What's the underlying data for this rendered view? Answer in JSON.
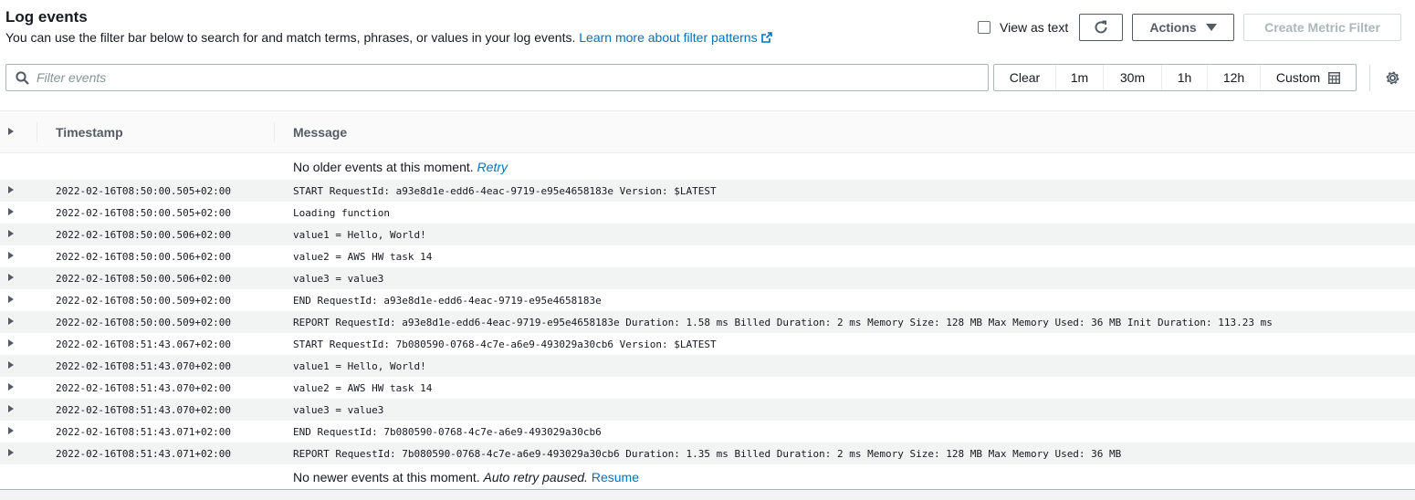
{
  "header": {
    "title": "Log events",
    "description": "You can use the filter bar below to search for and match terms, phrases, or values in your log events.",
    "learn_more": "Learn more about filter patterns"
  },
  "toolbar": {
    "view_as_text": "View as text",
    "actions_label": "Actions",
    "create_metric_filter": "Create Metric Filter"
  },
  "filter": {
    "placeholder": "Filter events"
  },
  "time_range": {
    "clear": "Clear",
    "m1": "1m",
    "m30": "30m",
    "h1": "1h",
    "h12": "12h",
    "custom": "Custom"
  },
  "table": {
    "col_timestamp": "Timestamp",
    "col_message": "Message",
    "older_text": "No older events at this moment.",
    "older_retry": "Retry",
    "newer_text": "No newer events at this moment.",
    "newer_paused": "Auto retry paused.",
    "newer_resume": "Resume",
    "rows": [
      {
        "ts": "2022-02-16T08:50:00.505+02:00",
        "msg": "START RequestId: a93e8d1e-edd6-4eac-9719-e95e4658183e Version: $LATEST"
      },
      {
        "ts": "2022-02-16T08:50:00.505+02:00",
        "msg": "Loading function"
      },
      {
        "ts": "2022-02-16T08:50:00.506+02:00",
        "msg": "value1 = Hello, World!"
      },
      {
        "ts": "2022-02-16T08:50:00.506+02:00",
        "msg": "value2 = AWS HW task 14"
      },
      {
        "ts": "2022-02-16T08:50:00.506+02:00",
        "msg": "value3 = value3"
      },
      {
        "ts": "2022-02-16T08:50:00.509+02:00",
        "msg": "END RequestId: a93e8d1e-edd6-4eac-9719-e95e4658183e"
      },
      {
        "ts": "2022-02-16T08:50:00.509+02:00",
        "msg": "REPORT RequestId: a93e8d1e-edd6-4eac-9719-e95e4658183e Duration: 1.58 ms Billed Duration: 2 ms Memory Size: 128 MB Max Memory Used: 36 MB Init Duration: 113.23 ms"
      },
      {
        "ts": "2022-02-16T08:51:43.067+02:00",
        "msg": "START RequestId: 7b080590-0768-4c7e-a6e9-493029a30cb6 Version: $LATEST"
      },
      {
        "ts": "2022-02-16T08:51:43.070+02:00",
        "msg": "value1 = Hello, World!"
      },
      {
        "ts": "2022-02-16T08:51:43.070+02:00",
        "msg": "value2 = AWS HW task 14"
      },
      {
        "ts": "2022-02-16T08:51:43.070+02:00",
        "msg": "value3 = value3"
      },
      {
        "ts": "2022-02-16T08:51:43.071+02:00",
        "msg": "END RequestId: 7b080590-0768-4c7e-a6e9-493029a30cb6"
      },
      {
        "ts": "2022-02-16T08:51:43.071+02:00",
        "msg": "REPORT RequestId: 7b080590-0768-4c7e-a6e9-493029a30cb6 Duration: 1.35 ms Billed Duration: 2 ms Memory Size: 128 MB Max Memory Used: 36 MB"
      }
    ]
  },
  "colors": {
    "link": "#0073bb",
    "text": "#16191f",
    "muted": "#545b64",
    "stripe": "#f2f3f3",
    "disabled": "#aab7b8"
  },
  "icons": [
    "external-link-icon",
    "refresh-icon",
    "caret-down-icon",
    "search-icon",
    "calendar-icon",
    "gear-icon",
    "expand-icon"
  ]
}
